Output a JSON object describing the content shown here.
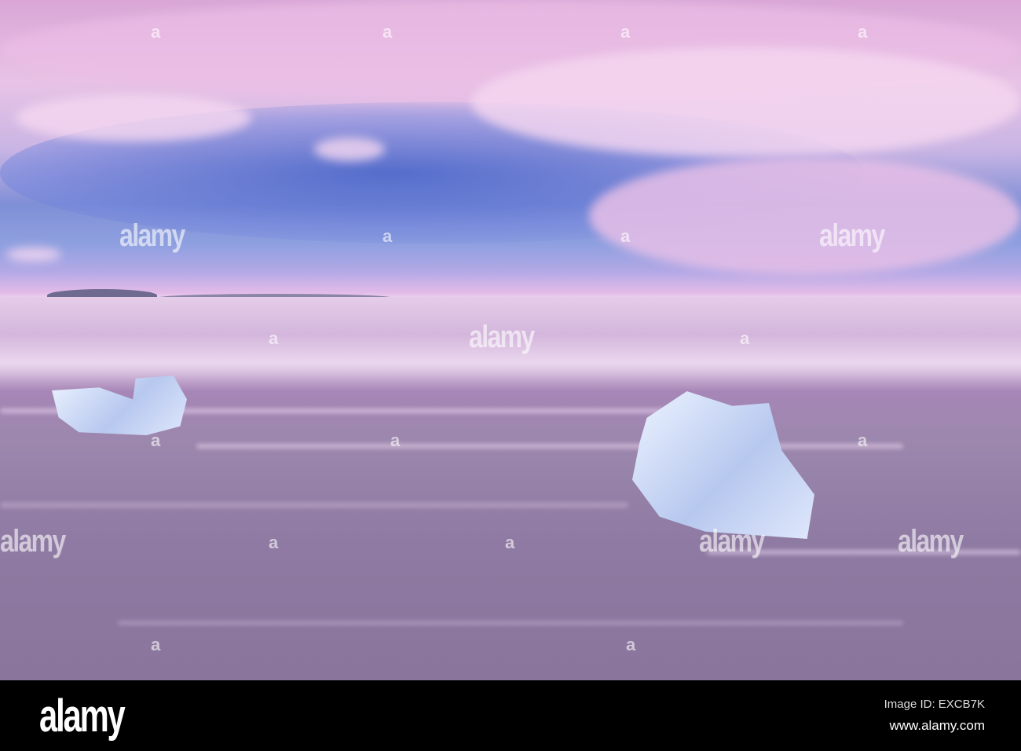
{
  "watermark": {
    "text": "alamy",
    "mark": "a"
  },
  "footer": {
    "logo": "alamy",
    "image_id": "Image ID: EXCB7K",
    "url": "www.alamy.com"
  }
}
